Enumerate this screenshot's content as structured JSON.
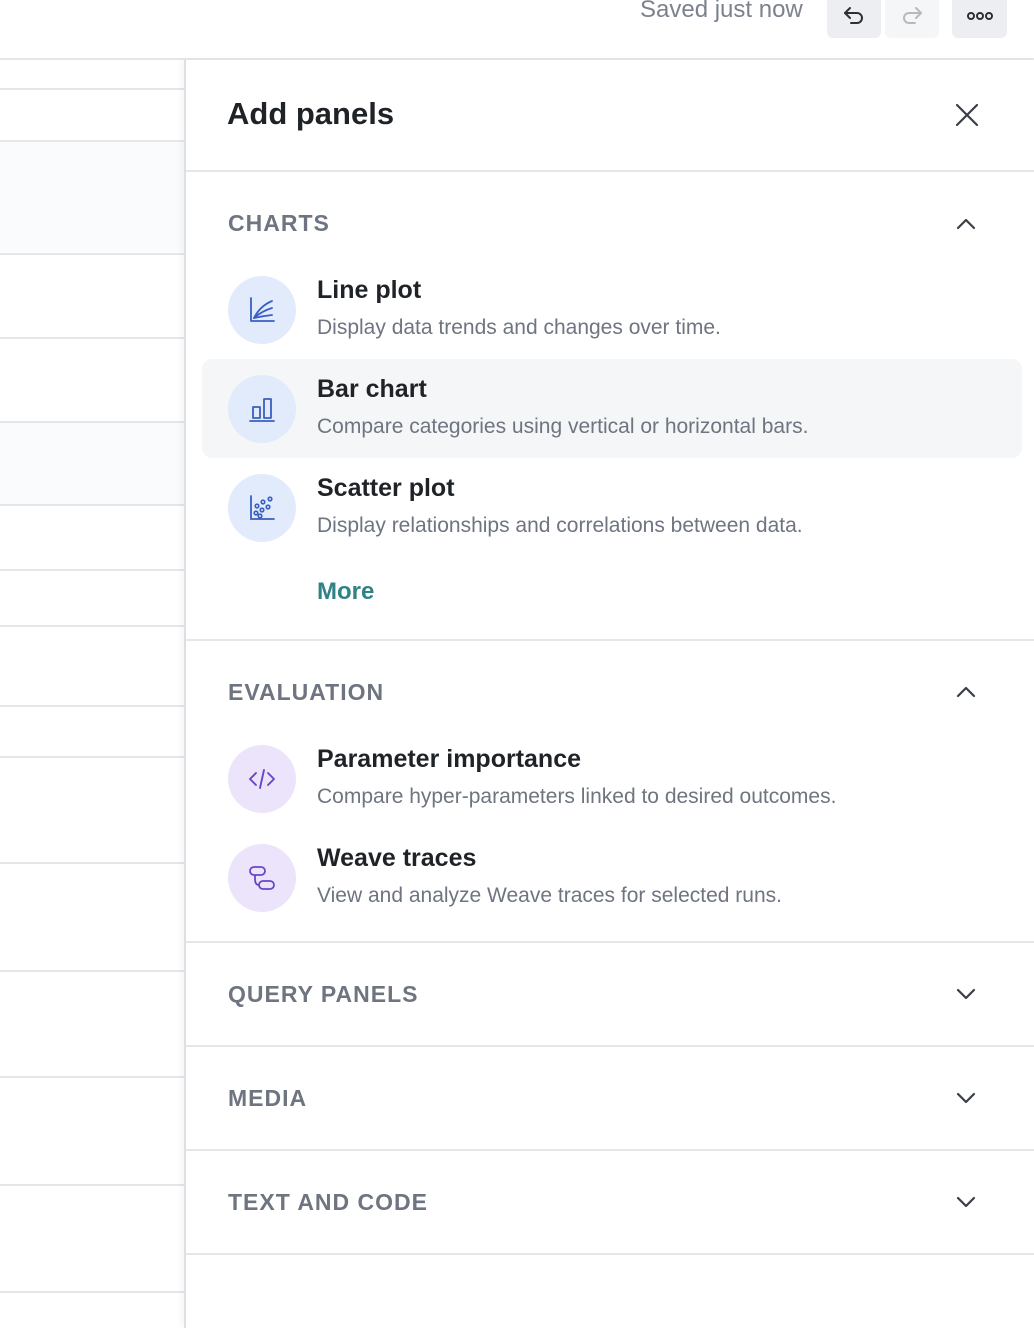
{
  "topbar": {
    "saved_status": "Saved just now",
    "undo_icon": "undo-icon",
    "redo_icon": "redo-icon",
    "more_icon": "more-horizontal-icon"
  },
  "panel": {
    "title": "Add panels",
    "close_icon": "close-icon",
    "sections": {
      "charts": {
        "title": "CHARTS",
        "expanded": true,
        "items": [
          {
            "title": "Line plot",
            "description": "Display data trends and changes over time.",
            "icon": "line-plot-icon"
          },
          {
            "title": "Bar chart",
            "description": "Compare categories using vertical or horizontal bars.",
            "icon": "bar-chart-icon"
          },
          {
            "title": "Scatter plot",
            "description": "Display relationships and correlations between data.",
            "icon": "scatter-plot-icon"
          }
        ],
        "more_label": "More"
      },
      "evaluation": {
        "title": "EVALUATION",
        "expanded": true,
        "items": [
          {
            "title": "Parameter importance",
            "description": "Compare hyper-parameters linked to desired outcomes.",
            "icon": "code-icon"
          },
          {
            "title": "Weave traces",
            "description": "View and analyze Weave traces for selected runs.",
            "icon": "weave-traces-icon"
          }
        ]
      },
      "query_panels": {
        "title": "QUERY PANELS",
        "expanded": false
      },
      "media": {
        "title": "MEDIA",
        "expanded": false
      },
      "text_and_code": {
        "title": "TEXT AND CODE",
        "expanded": false
      }
    }
  },
  "colors": {
    "accent_link": "#2f8286",
    "icon_blue_bg": "#e1ebfb",
    "icon_blue_stroke": "#3b5fc0",
    "icon_purple_bg": "#ebe4fa",
    "icon_purple_stroke": "#6b45c9",
    "hover_row_bg": "#f5f6f7"
  }
}
